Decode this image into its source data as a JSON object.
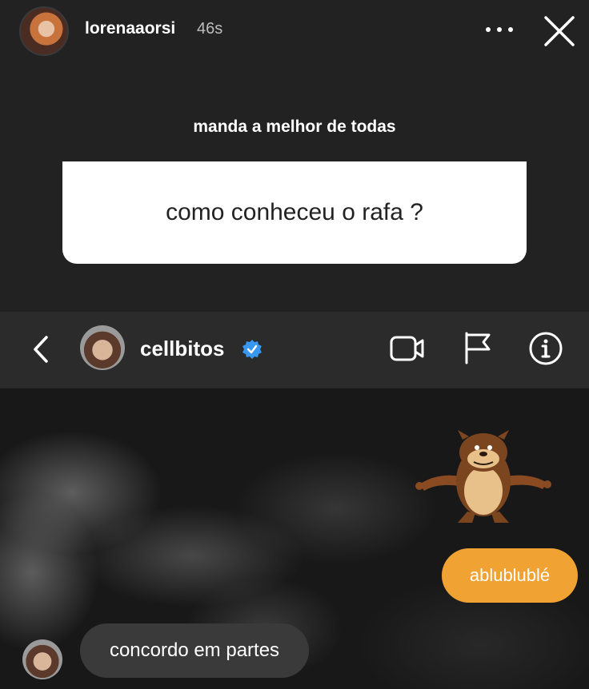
{
  "story": {
    "username": "lorenaaorsi",
    "time": "46s",
    "prompt_label": "manda a melhor de todas",
    "question": "como conheceu o rafa ?",
    "icons": {
      "more": "more-dots-icon",
      "close": "close-icon"
    }
  },
  "dm": {
    "username": "cellbitos",
    "verified": true,
    "icons": [
      "back-icon",
      "video-camera-icon",
      "flag-icon",
      "info-icon"
    ]
  },
  "messages": [
    {
      "type": "sticker",
      "sender": "me",
      "sticker": "tasmanian-devil-sticker"
    },
    {
      "type": "text",
      "sender": "me",
      "text": "ablublublé"
    },
    {
      "type": "text",
      "sender": "cellbitos",
      "text": "concordo em partes"
    }
  ],
  "colors": {
    "outgoing_bubble": "#f0a232",
    "incoming_bubble": "#3a3a3a",
    "verified_badge": "#3897f0"
  }
}
